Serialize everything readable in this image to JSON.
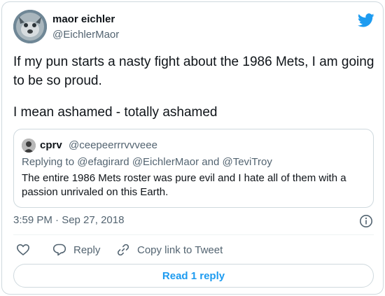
{
  "tweet": {
    "author_name": "maor eichler",
    "author_handle": "@EichlerMaor",
    "text_line1": "If my pun starts a nasty fight about the 1986 Mets, I am going to be so proud.",
    "text_line2": "I mean ashamed - totally ashamed",
    "timestamp": "3:59 PM · Sep 27, 2018"
  },
  "quoted": {
    "author_name": "cprv",
    "author_handle": "@ceepeerrrvvveee",
    "reply_prefix": "Replying to ",
    "reply_user1": "@efagirard",
    "reply_user2": "@EichlerMaor",
    "reply_and": " and ",
    "reply_user3": "@TeviTroy",
    "body": "The entire 1986 Mets roster was pure evil and I hate all of them with a passion unrivaled on this Earth."
  },
  "actions": {
    "reply_label": "Reply",
    "copy_label": "Copy link to Tweet"
  },
  "footer": {
    "read_replies_label": "Read 1 reply"
  },
  "colors": {
    "twitter_blue": "#1d9bf0",
    "secondary_text": "#536471",
    "border": "#cfd9de"
  },
  "icons": [
    "twitter-bird-icon",
    "info-icon",
    "heart-icon",
    "reply-bubble-icon",
    "link-icon"
  ]
}
